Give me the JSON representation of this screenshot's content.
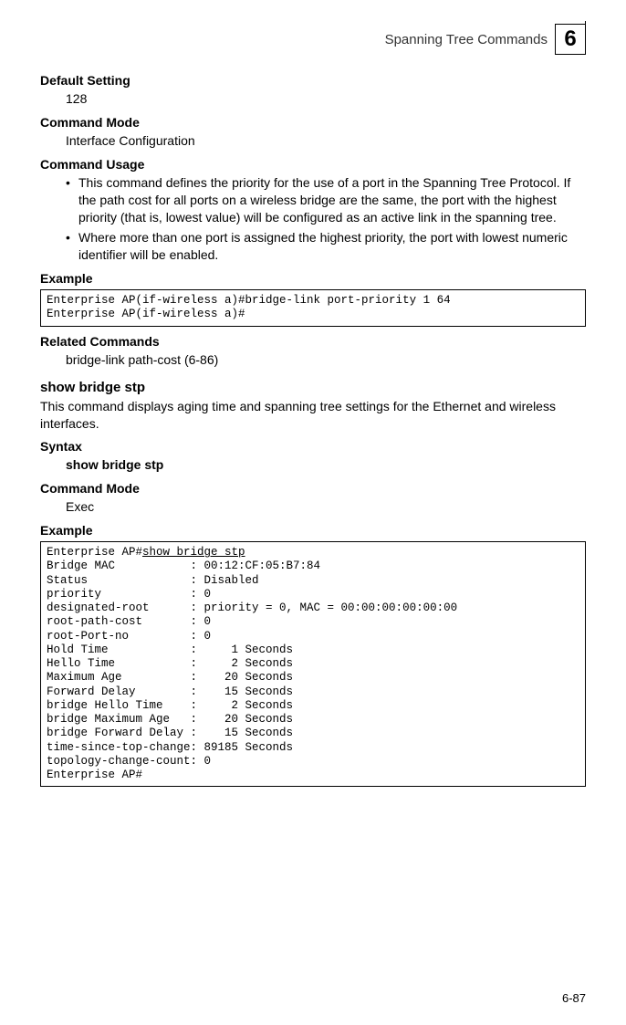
{
  "header": {
    "right_text": "Spanning Tree Commands",
    "chapter_number": "6"
  },
  "sections": {
    "default_setting": {
      "title": "Default Setting",
      "value": "128"
    },
    "command_mode_1": {
      "title": "Command Mode",
      "value": "Interface Configuration"
    },
    "command_usage": {
      "title": "Command Usage",
      "bullets": [
        "This command defines the priority for the use of a port in the Spanning Tree Protocol. If the path cost for all ports on a wireless bridge are the same, the port with the highest priority (that is, lowest value) will be configured as an active link in the spanning tree.",
        "Where more than one port is assigned the highest priority, the port with lowest numeric identifier will be enabled."
      ]
    },
    "example_1": {
      "title": "Example",
      "code": "Enterprise AP(if-wireless a)#bridge-link port-priority 1 64\nEnterprise AP(if-wireless a)#"
    },
    "related_commands": {
      "title": "Related Commands",
      "value": "bridge-link path-cost (6-86)"
    },
    "command_name": {
      "title": "show bridge stp",
      "desc": "This command displays aging time and spanning tree settings for the Ethernet and wireless interfaces."
    },
    "syntax": {
      "title": "Syntax",
      "value": "show bridge stp"
    },
    "command_mode_2": {
      "title": "Command Mode",
      "value": "Exec"
    },
    "example_2": {
      "title": "Example",
      "prompt_prefix": "Enterprise AP#",
      "prompt_cmd": "show bridge stp",
      "code_body": "\nBridge MAC           : 00:12:CF:05:B7:84\nStatus               : Disabled\npriority             : 0\ndesignated-root      : priority = 0, MAC = 00:00:00:00:00:00\nroot-path-cost       : 0\nroot-Port-no         : 0\nHold Time            :     1 Seconds\nHello Time           :     2 Seconds\nMaximum Age          :    20 Seconds\nForward Delay        :    15 Seconds\nbridge Hello Time    :     2 Seconds\nbridge Maximum Age   :    20 Seconds\nbridge Forward Delay :    15 Seconds\ntime-since-top-change: 89185 Seconds\ntopology-change-count: 0\nEnterprise AP#"
    }
  },
  "footer": {
    "page": "6-87"
  }
}
